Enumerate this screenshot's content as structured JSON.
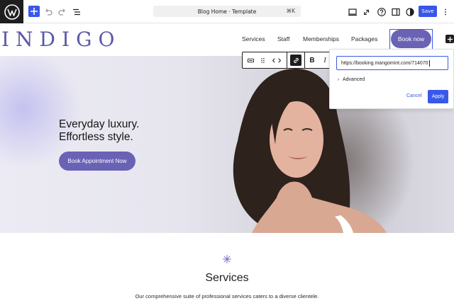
{
  "editor": {
    "document_title": "Blog Home · Template",
    "command_shortcut": "⌘K",
    "save_label": "Save",
    "icons": [
      "wordpress-logo",
      "plus-icon",
      "undo-icon",
      "redo-icon",
      "list-view-icon",
      "desktop-view-icon",
      "external-icon",
      "help-icon",
      "settings-sidebar-icon",
      "styles-icon",
      "more-options-icon"
    ]
  },
  "site": {
    "logo_text": "INDIGO",
    "nav": [
      "Services",
      "Staff",
      "Memberships",
      "Packages"
    ],
    "book_now_label": "Book now"
  },
  "hero": {
    "headline_line1": "Everyday luxury.",
    "headline_line2": "Effortless style.",
    "button_label": "Book Appointment Now"
  },
  "block_toolbar": {
    "bold_label": "B",
    "italic_label": "I"
  },
  "link_popover": {
    "url_value": "https://booking.mangomint.com/714070",
    "advanced_label": "Advanced",
    "cancel_label": "Cancel",
    "apply_label": "Apply"
  },
  "services": {
    "title": "Services",
    "description": "Our comprehensive suite of professional services caters to a diverse clientele."
  },
  "colors": {
    "accent": "#3858e9",
    "brand": "#6a62b4",
    "logo": "#5c58a8"
  }
}
